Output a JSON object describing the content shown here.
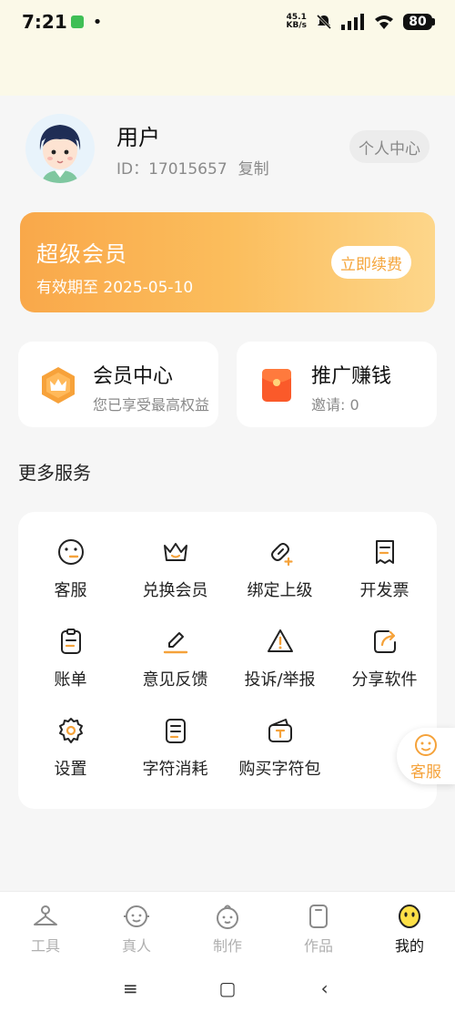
{
  "status_bar": {
    "time": "7:21",
    "net_speed_value": "45.1",
    "net_speed_unit": "KB/s",
    "battery": "80"
  },
  "profile": {
    "username": "用户",
    "user_id": "ID：17015657",
    "copy_label": "复制",
    "personal_center_label": "个人中心"
  },
  "vip_card": {
    "title": "超级会员",
    "expiry": "有效期至 2025-05-10",
    "renew_label": "立即续费",
    "colors": {
      "start": "#f9a84a",
      "end": "#fdd68a"
    }
  },
  "quick_cards": [
    {
      "title": "会员中心",
      "subtitle": "您已享受最高权益",
      "icon": "crown-hexagon-icon"
    },
    {
      "title": "推广赚钱",
      "subtitle": "邀请: 0",
      "icon": "red-envelope-icon"
    }
  ],
  "more_services": {
    "title": "更多服务",
    "items": [
      {
        "label": "客服",
        "icon": "smile-face-icon"
      },
      {
        "label": "兑换会员",
        "icon": "crown-icon"
      },
      {
        "label": "绑定上级",
        "icon": "link-add-icon"
      },
      {
        "label": "开发票",
        "icon": "receipt-icon"
      },
      {
        "label": "账单",
        "icon": "clipboard-icon"
      },
      {
        "label": "意见反馈",
        "icon": "pencil-icon"
      },
      {
        "label": "投诉/举报",
        "icon": "warning-icon"
      },
      {
        "label": "分享软件",
        "icon": "share-icon"
      },
      {
        "label": "设置",
        "icon": "gear-icon"
      },
      {
        "label": "字符消耗",
        "icon": "document-icon"
      },
      {
        "label": "购买字符包",
        "icon": "wallet-icon"
      }
    ]
  },
  "floating_service": {
    "label": "客服"
  },
  "tab_bar": {
    "tabs": [
      {
        "label": "工具",
        "icon": "hanger-icon",
        "active": false
      },
      {
        "label": "真人",
        "icon": "face-icon",
        "active": false
      },
      {
        "label": "制作",
        "icon": "baby-face-icon",
        "active": false
      },
      {
        "label": "作品",
        "icon": "phone-card-icon",
        "active": false
      },
      {
        "label": "我的",
        "icon": "yellow-face-icon",
        "active": true
      }
    ]
  },
  "nav_bar": {
    "menu": "≡",
    "home": "▢",
    "back": "‹"
  },
  "accent_color": "#f5a23a"
}
